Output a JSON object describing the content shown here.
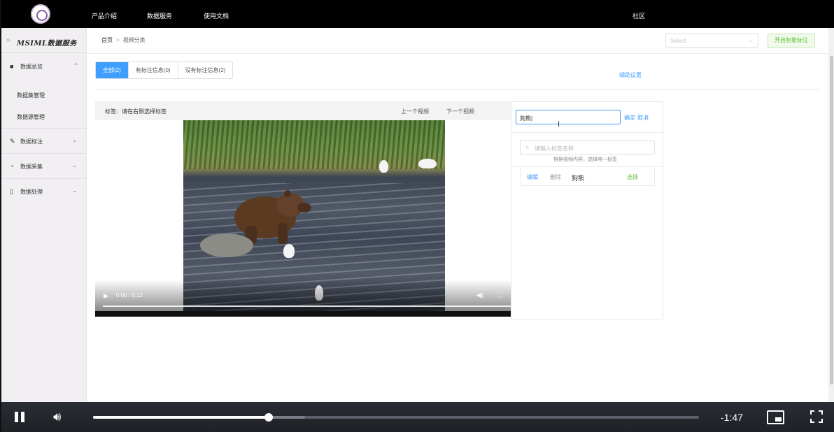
{
  "topnav": {
    "items": [
      "产品介绍",
      "数据服务",
      "使用文档"
    ],
    "community": "社区"
  },
  "sidebar": {
    "brand": "MSIML数据服务",
    "menus": [
      {
        "label": "数据总览",
        "icon": "grid-icon",
        "expanded": true,
        "children": [
          "数据集管理",
          "数据源管理"
        ]
      },
      {
        "label": "数据标注",
        "icon": "pen-icon",
        "expanded": false
      },
      {
        "label": "数据采集",
        "icon": "clock-icon",
        "expanded": false
      },
      {
        "label": "数据处理",
        "icon": "bookmark-icon",
        "expanded": false
      }
    ]
  },
  "header": {
    "breadcrumb": [
      "首页",
      "视频分类"
    ],
    "select_placeholder": "Select",
    "smart_label_button": "开启智能标注"
  },
  "tabs": {
    "items": [
      "全部(2)",
      "有标注信息(0)",
      "没有标注信息(2)"
    ],
    "active": 0
  },
  "assist_settings": "辅助设置",
  "video_panel": {
    "label_text": "标签：请在右侧选择标签",
    "prev": "上一个视频",
    "next": "下一个视频",
    "time": "0:00 / 0:12"
  },
  "label_panel": {
    "input_value": "狗熊|",
    "confirm": "确定",
    "cancel": "取消",
    "search_placeholder": "请输入标签名称",
    "hint": "根据视频内容，选择唯一标签",
    "rows": [
      {
        "edit": "编辑",
        "delete": "删除",
        "name": "狗熊",
        "choose": "选择"
      }
    ]
  },
  "player": {
    "remaining": "-1:47",
    "progress": 0.29,
    "buffered": 0.35
  },
  "colors": {
    "primary": "#409eff",
    "success": "#67c23a",
    "topbar": "#000000",
    "sidebar": "#f1eff2"
  }
}
